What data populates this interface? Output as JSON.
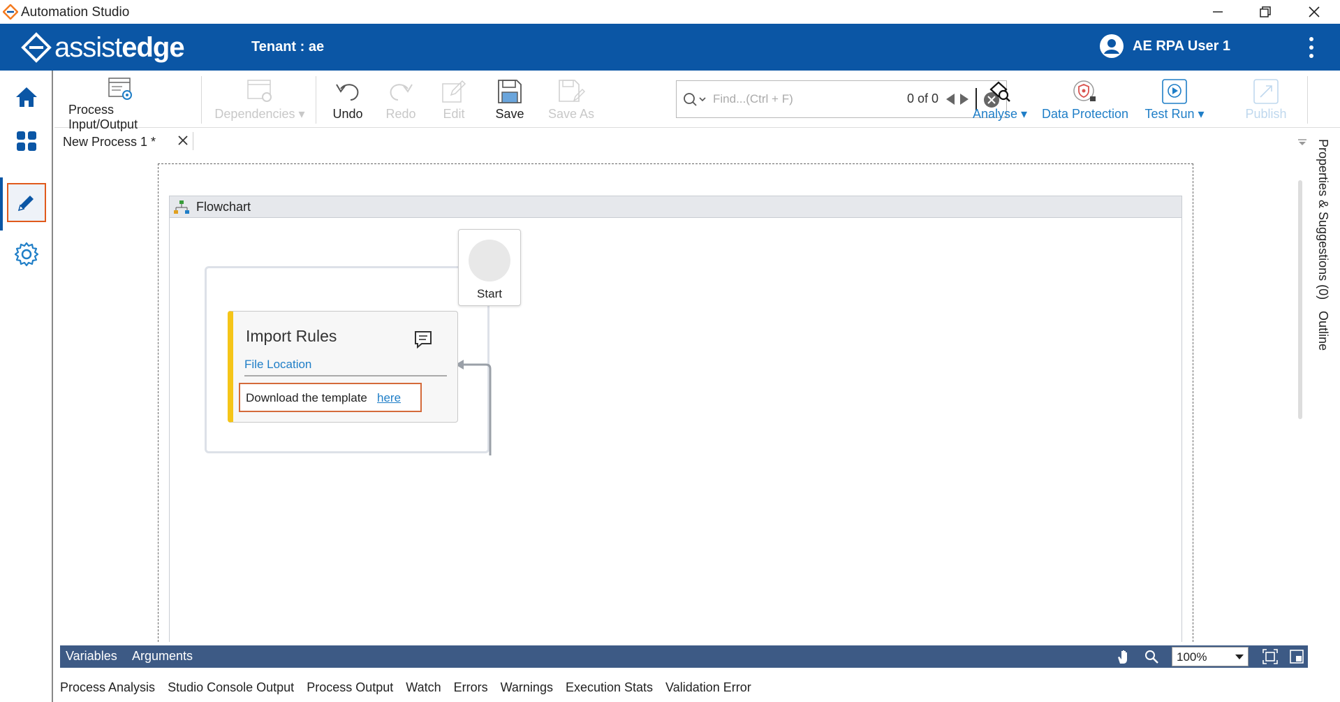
{
  "window": {
    "title": "Automation Studio"
  },
  "header": {
    "logo_light": "assist",
    "logo_bold": "edge",
    "tenant_label": "Tenant :",
    "tenant_value": "ae",
    "user_name": "AE RPA User 1"
  },
  "toolbar": {
    "process_io": "Process Input/Output",
    "dependencies": "Dependencies",
    "undo": "Undo",
    "redo": "Redo",
    "edit": "Edit",
    "save": "Save",
    "save_as": "Save As",
    "find_placeholder": "Find...(Ctrl + F)",
    "find_count": "0 of 0",
    "analyse": "Analyse",
    "data_protection": "Data Protection",
    "test_run": "Test Run",
    "publish": "Publish"
  },
  "document_tab": {
    "label": "New Process 1 *"
  },
  "flowchart": {
    "title": "Flowchart",
    "start_label": "Start",
    "activity": {
      "title": "Import Rules",
      "subtitle": "File Location",
      "download_text": "Download the template",
      "download_link": "here"
    }
  },
  "bottom_bar": {
    "variables": "Variables",
    "arguments": "Arguments",
    "zoom": "100%"
  },
  "bottom_tabs": [
    "Process Analysis",
    "Studio Console Output",
    "Process Output",
    "Watch",
    "Errors",
    "Warnings",
    "Execution Stats",
    "Validation Error"
  ],
  "right_panel": {
    "properties": "Properties & Suggestions (0)",
    "outline": "Outline"
  },
  "colors": {
    "brand_blue": "#0b56a5",
    "accent_orange": "#f47b20",
    "link_blue": "#1f7ec7",
    "activity_stripe": "#f5c518"
  }
}
